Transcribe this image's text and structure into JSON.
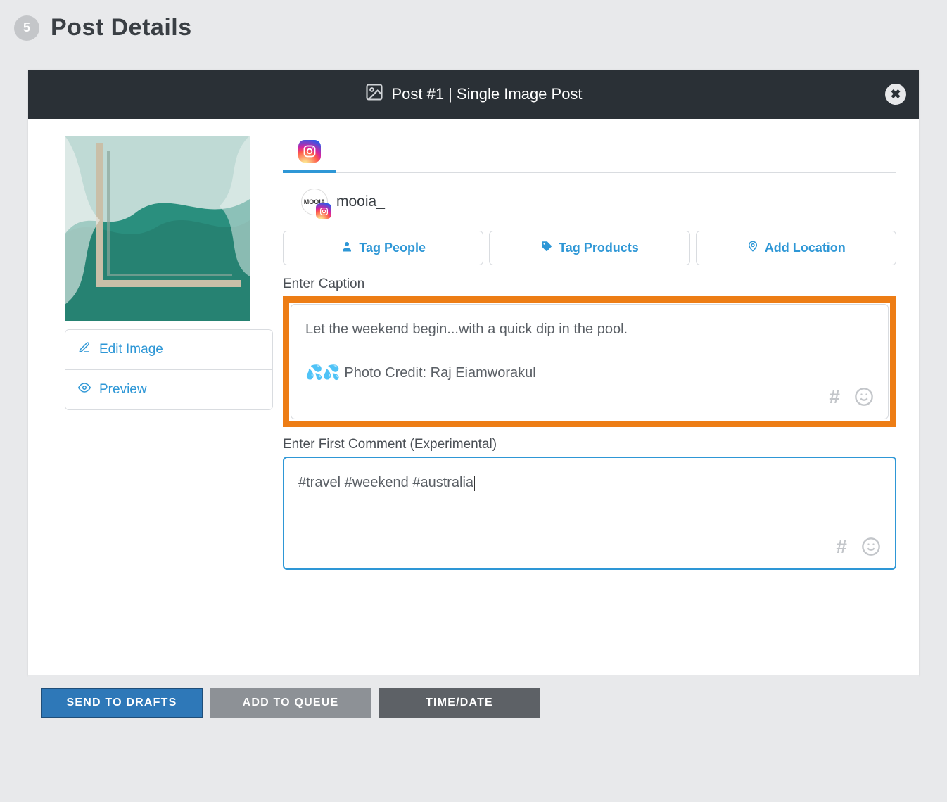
{
  "header": {
    "step_number": "5",
    "title": "Post Details"
  },
  "card": {
    "header_text": "Post #1 | Single Image Post"
  },
  "image_actions": {
    "edit": "Edit Image",
    "preview": "Preview"
  },
  "account": {
    "name": "mooia_",
    "avatar_text": "MOOIA"
  },
  "buttons": {
    "tag_people": "Tag People",
    "tag_products": "Tag Products",
    "add_location": "Add Location"
  },
  "caption": {
    "label": "Enter Caption",
    "value": "Let the weekend begin...with a quick dip in the pool.\n\n💦💦 Photo Credit: Raj Eiamworakul"
  },
  "first_comment": {
    "label": "Enter First Comment (Experimental)",
    "value": "#travel #weekend #australia"
  },
  "footer": {
    "drafts": "Send to Drafts",
    "queue": "Add to Queue",
    "time_date": "Time/Date"
  }
}
